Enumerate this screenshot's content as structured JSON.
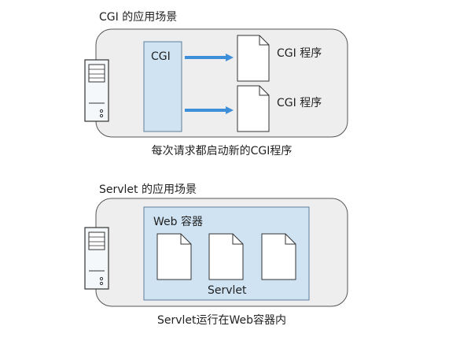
{
  "cgi_section": {
    "title": "CGI 的应用场景",
    "container_label": "CGI",
    "program_labels": [
      "CGI 程序",
      "CGI 程序"
    ],
    "caption": "每次请求都启动新的CGI程序"
  },
  "servlet_section": {
    "title": "Servlet 的应用场景",
    "container_label": "Web 容器",
    "servlet_label": "Servlet",
    "caption": "Servlet运行在Web容器内"
  },
  "colors": {
    "panel_fill": "#eeeeee",
    "panel_stroke": "#555555",
    "box_fill": "#cfe3f3",
    "box_stroke": "#5f7f9b",
    "arrow": "#3d8fd9",
    "server_fill": "#f4f8fb"
  }
}
